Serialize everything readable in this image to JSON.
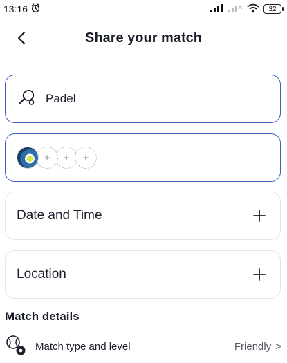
{
  "status_bar": {
    "time": "13:16",
    "battery": "32"
  },
  "header": {
    "title": "Share your match"
  },
  "sport": {
    "label": "Padel",
    "icon": "padel-racket-icon"
  },
  "players": {
    "slot_glyph": "+",
    "empty_slots": 3
  },
  "rows": {
    "date_label": "Date and Time",
    "location_label": "Location"
  },
  "match_details": {
    "section_title": "Match details",
    "type_label": "Match type and level",
    "type_value": "Friendly",
    "chevron": ">"
  },
  "colors": {
    "accent_border": "#3f5fbf",
    "muted_border": "#e3e5ea",
    "text": "#1a1f2b"
  }
}
